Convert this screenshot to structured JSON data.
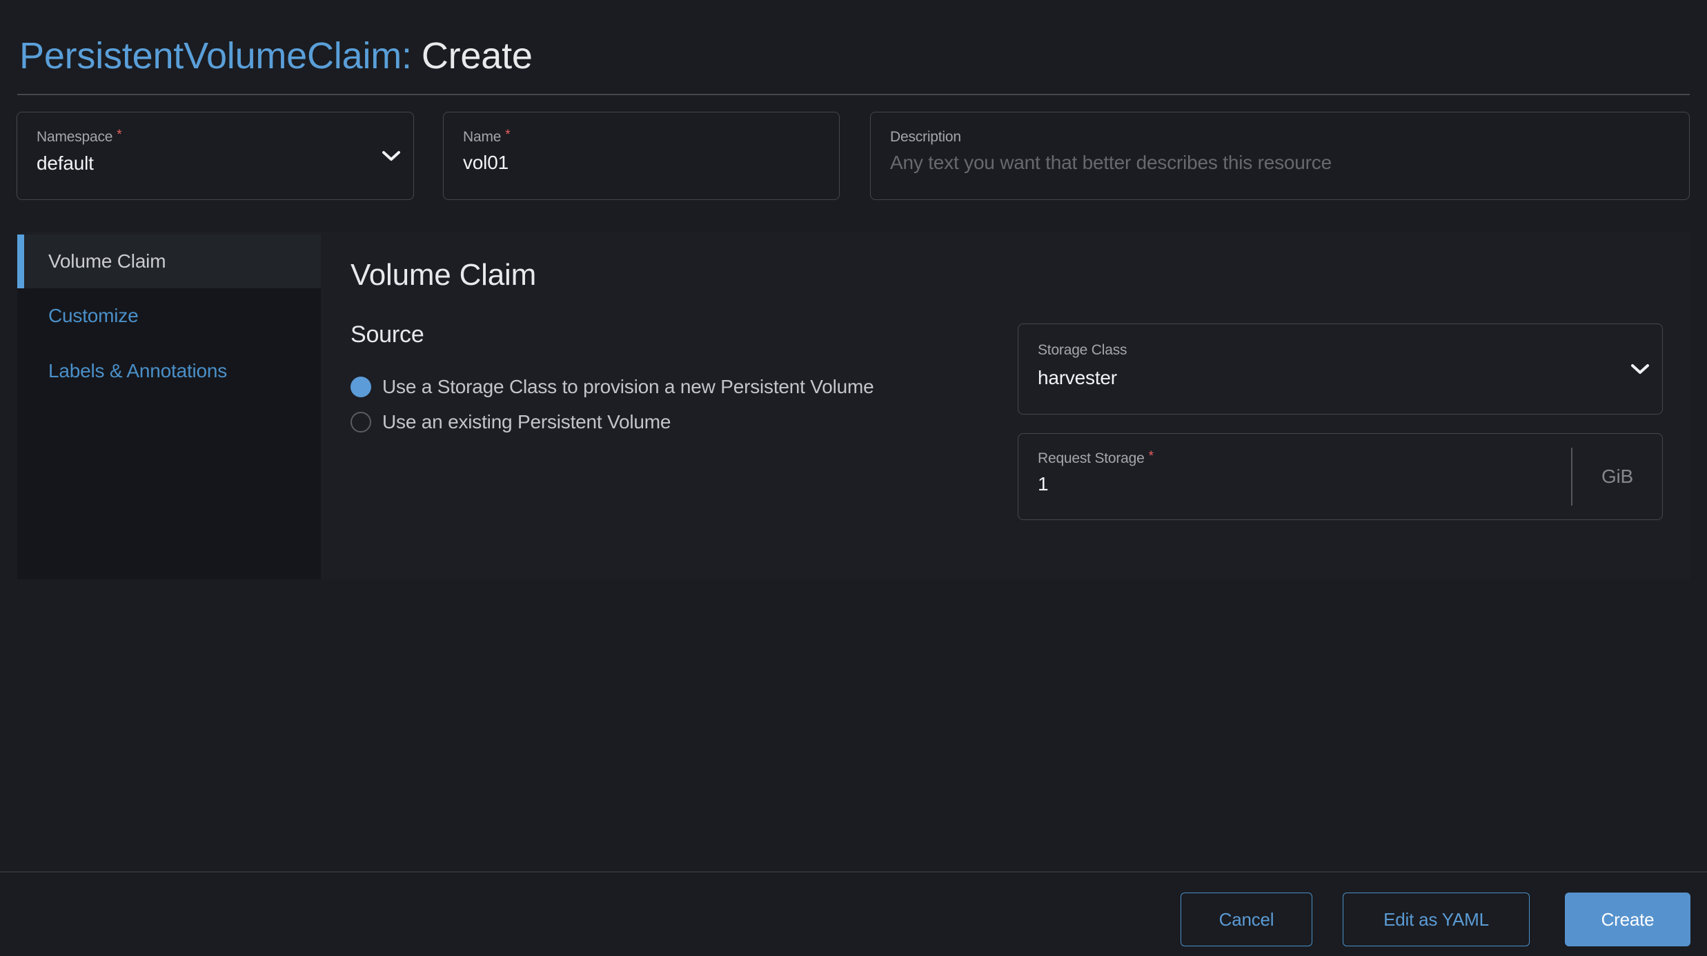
{
  "header": {
    "title_resource": "PersistentVolumeClaim:",
    "title_action": "Create"
  },
  "form": {
    "namespace": {
      "label": "Namespace",
      "required_marker": "*",
      "value": "default"
    },
    "name": {
      "label": "Name",
      "required_marker": "*",
      "value": "vol01"
    },
    "description": {
      "label": "Description",
      "placeholder": "Any text you want that better describes this resource"
    }
  },
  "sidebar": {
    "tabs": [
      {
        "label": "Volume Claim"
      },
      {
        "label": "Customize"
      },
      {
        "label": "Labels & Annotations"
      }
    ]
  },
  "content": {
    "heading": "Volume Claim",
    "source_heading": "Source",
    "radio_options": [
      {
        "label": "Use a Storage Class to provision a new Persistent Volume",
        "selected": true
      },
      {
        "label": "Use an existing Persistent Volume",
        "selected": false
      }
    ],
    "storage_class": {
      "label": "Storage Class",
      "value": "harvester"
    },
    "request_storage": {
      "label": "Request Storage",
      "required_marker": "*",
      "value": "1",
      "unit": "GiB"
    }
  },
  "footer": {
    "cancel_label": "Cancel",
    "edit_yaml_label": "Edit as YAML",
    "create_label": "Create"
  },
  "colors": {
    "title_blue": "#5a9fd9",
    "link_blue": "#4a90c9",
    "active_tab_bar": "#58a0dc",
    "primary_button": "#5693ce",
    "required_red": "#e95f5f",
    "page_bg": "#1a1c21",
    "sidebar_bg": "#15161b"
  }
}
